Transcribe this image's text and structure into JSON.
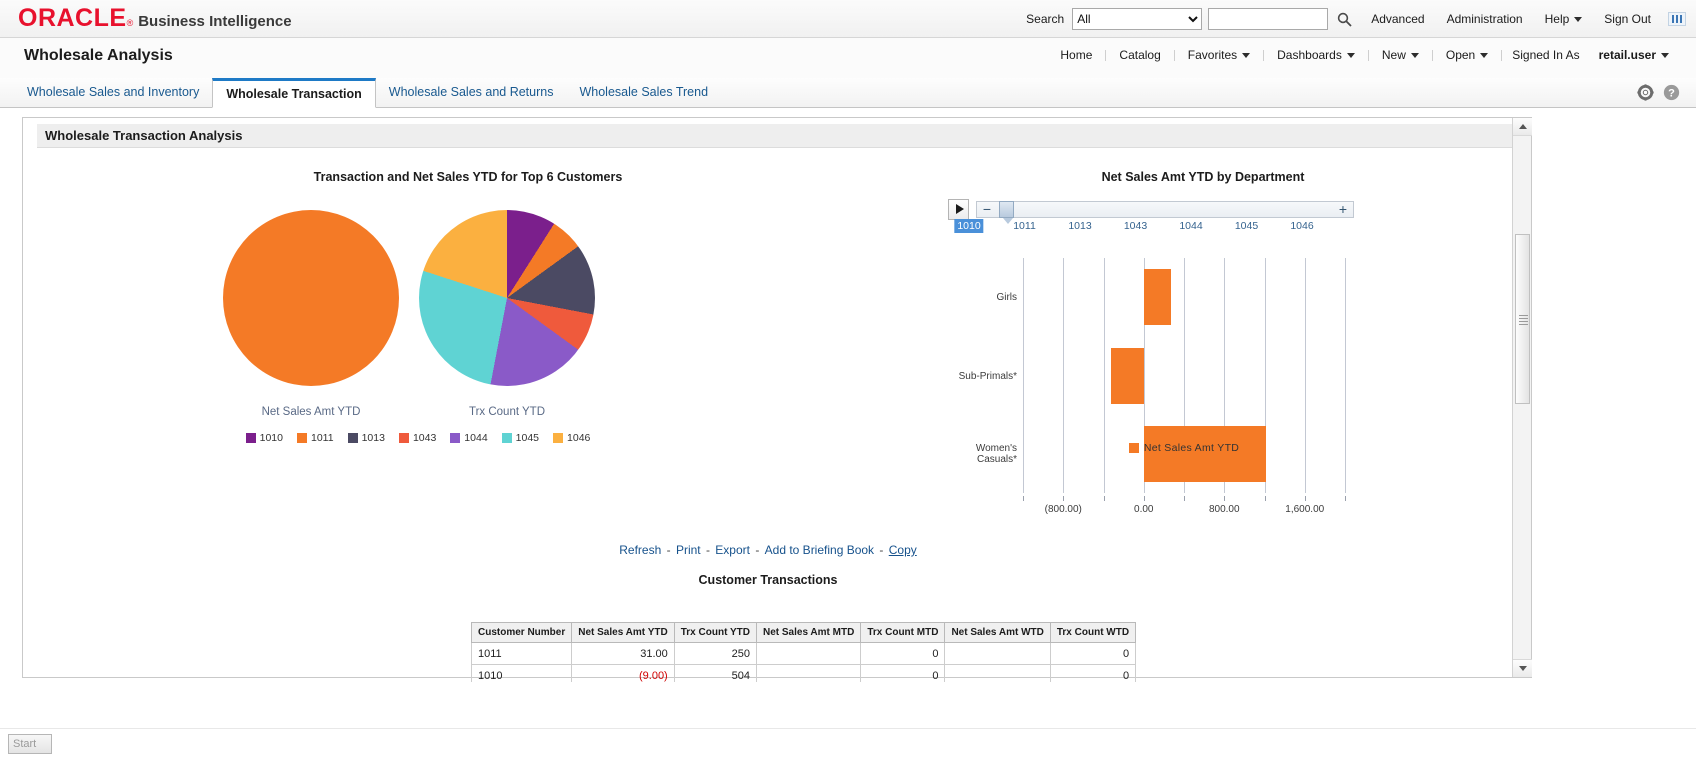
{
  "header": {
    "brand": "ORACLE",
    "brand_tm": "®",
    "product": "Business Intelligence",
    "search_label": "Search",
    "search_scope_selected": "All",
    "search_scope_options": [
      "All"
    ],
    "search_value": "",
    "search_placeholder": "",
    "search_icon": "search-icon",
    "links": [
      {
        "label": "Advanced",
        "name": "advanced-link"
      },
      {
        "label": "Administration",
        "name": "administration-link"
      },
      {
        "label": "Help",
        "name": "help-menu",
        "caret": true
      },
      {
        "label": "Sign Out",
        "name": "sign-out-link"
      }
    ],
    "grid_icon": "grid-icon"
  },
  "dashboard": {
    "title": "Wholesale Analysis",
    "nav": [
      {
        "label": "Home",
        "caret": false
      },
      {
        "label": "Catalog",
        "caret": false
      },
      {
        "label": "Favorites",
        "caret": true
      },
      {
        "label": "Dashboards",
        "caret": true
      },
      {
        "label": "New",
        "caret": true
      },
      {
        "label": "Open",
        "caret": true
      }
    ],
    "signed_in_label": "Signed In As",
    "signed_in_user": "retail.user",
    "tabs": [
      {
        "label": "Wholesale Sales and Inventory",
        "active": false
      },
      {
        "label": "Wholesale Transaction",
        "active": true
      },
      {
        "label": "Wholesale Sales and Returns",
        "active": false
      },
      {
        "label": "Wholesale Sales Trend",
        "active": false
      }
    ],
    "tab_icons": [
      "gear-icon",
      "help-circle-icon"
    ],
    "section_title": "Wholesale Transaction Analysis"
  },
  "action_links": {
    "items": [
      "Refresh",
      "Print",
      "Export",
      "Add to Briefing Book",
      "Copy"
    ],
    "separator": "-"
  },
  "chart_data": [
    {
      "type": "pie",
      "name": "transaction-and-net-sales-pies",
      "title": "Transaction and Net Sales YTD for Top 6 Customers",
      "legend_position": "bottom",
      "legend": [
        "1010",
        "1011",
        "1013",
        "1043",
        "1044",
        "1045",
        "1046"
      ],
      "colors": {
        "1010": "#7b1f8c",
        "1011": "#f47a26",
        "1013": "#4b4a63",
        "1043": "#ef5a3c",
        "1044": "#8a5ac8",
        "1045": "#5fd3d3",
        "1046": "#fbb040"
      },
      "pies": [
        {
          "label": "Net Sales Amt YTD",
          "slices": [
            {
              "category": "1011",
              "value": 100
            }
          ]
        },
        {
          "label": "Trx Count YTD",
          "slices": [
            {
              "category": "1010",
              "value": 9
            },
            {
              "category": "1011",
              "value": 6
            },
            {
              "category": "1013",
              "value": 13
            },
            {
              "category": "1043",
              "value": 7
            },
            {
              "category": "1044",
              "value": 18
            },
            {
              "category": "1045",
              "value": 27
            },
            {
              "category": "1046",
              "value": 20
            }
          ]
        }
      ]
    },
    {
      "type": "bar",
      "name": "net-sales-by-department",
      "title": "Net Sales Amt YTD by Department",
      "orientation": "horizontal",
      "categories": [
        "Girls",
        "Sub-Primals*",
        "Women's Casuals*"
      ],
      "series": [
        {
          "name": "Net Sales Amt YTD",
          "values": [
            270,
            -330,
            1210
          ]
        }
      ],
      "xlabel": "",
      "ylabel": "",
      "xlim": [
        -1200,
        2000
      ],
      "xticks": [
        "(800.00)",
        "0.00",
        "800.00",
        "1,600.00"
      ],
      "xtick_values": [
        -800,
        0,
        800,
        1600
      ],
      "grid": true,
      "legend_position": "bottom",
      "legend": [
        "Net Sales Amt YTD"
      ],
      "color": "#f47a26",
      "slider": {
        "play_icon": "play-icon",
        "minus_label": "−",
        "plus_label": "+",
        "selected": "1010",
        "ticks": [
          "1010",
          "1011",
          "1013",
          "1043",
          "1044",
          "1045",
          "1046"
        ]
      }
    }
  ],
  "table": {
    "title": "Customer Transactions",
    "columns": [
      "Customer Number",
      "Net Sales Amt YTD",
      "Trx Count YTD",
      "Net Sales Amt MTD",
      "Trx Count MTD",
      "Net Sales Amt WTD",
      "Trx Count WTD"
    ],
    "rows": [
      {
        "customer": "1011",
        "net_sales_ytd": "31.00",
        "net_sales_ytd_negative": false,
        "trx_ytd": "250",
        "net_sales_mtd": "",
        "trx_mtd": "0",
        "net_sales_wtd": "",
        "trx_wtd": "0"
      },
      {
        "customer": "1010",
        "net_sales_ytd": "(9.00)",
        "net_sales_ytd_negative": true,
        "trx_ytd": "504",
        "net_sales_mtd": "",
        "trx_mtd": "0",
        "net_sales_wtd": "",
        "trx_wtd": "0"
      }
    ]
  },
  "taskbar": {
    "start_label": "Start"
  }
}
